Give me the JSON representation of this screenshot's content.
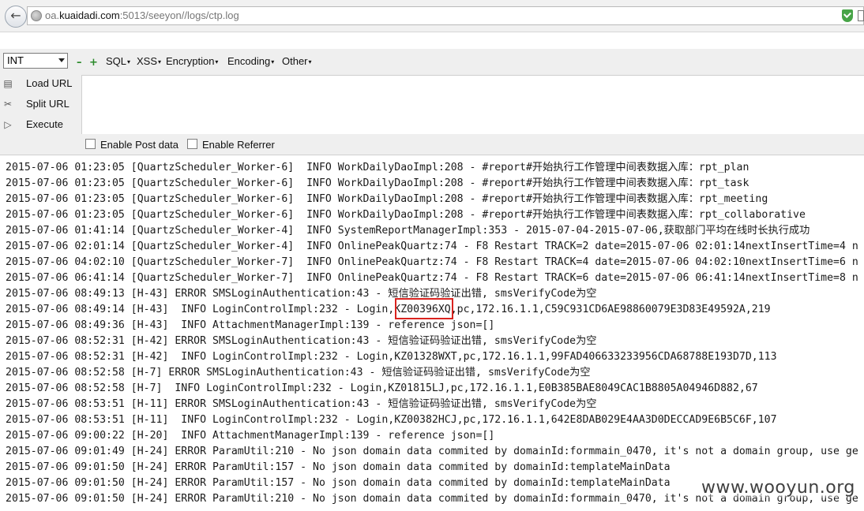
{
  "browser": {
    "url_prefix": "oa.",
    "url_domain": "kuaidadi.com",
    "url_suffix": ":5013/seeyon//logs/ctp.log"
  },
  "hackbar": {
    "select_value": "INT",
    "menus": [
      "SQL",
      "XSS",
      "Encryption",
      "Encoding",
      "Other"
    ],
    "side": [
      "Load URL",
      "Split URL",
      "Execute"
    ],
    "checkboxes": [
      "Enable Post data",
      "Enable Referrer"
    ]
  },
  "log_lines": [
    "2015-07-06 01:23:05 [QuartzScheduler_Worker-6]  INFO WorkDailyDaoImpl:208 - #report#开始执行工作管理中间表数据入库：rpt_plan",
    "2015-07-06 01:23:05 [QuartzScheduler_Worker-6]  INFO WorkDailyDaoImpl:208 - #report#开始执行工作管理中间表数据入库：rpt_task",
    "2015-07-06 01:23:05 [QuartzScheduler_Worker-6]  INFO WorkDailyDaoImpl:208 - #report#开始执行工作管理中间表数据入库：rpt_meeting",
    "2015-07-06 01:23:05 [QuartzScheduler_Worker-6]  INFO WorkDailyDaoImpl:208 - #report#开始执行工作管理中间表数据入库：rpt_collaborative",
    "2015-07-06 01:41:14 [QuartzScheduler_Worker-4]  INFO SystemReportManagerImpl:353 - 2015-07-04-2015-07-06,获取部门平均在线时长执行成功",
    "2015-07-06 02:01:14 [QuartzScheduler_Worker-4]  INFO OnlinePeakQuartz:74 - F8 Restart TRACK=2 date=2015-07-06 02:01:14nextInsertTime=4 n",
    "2015-07-06 04:02:10 [QuartzScheduler_Worker-7]  INFO OnlinePeakQuartz:74 - F8 Restart TRACK=4 date=2015-07-06 04:02:10nextInsertTime=6 n",
    "2015-07-06 06:41:14 [QuartzScheduler_Worker-7]  INFO OnlinePeakQuartz:74 - F8 Restart TRACK=6 date=2015-07-06 06:41:14nextInsertTime=8 n",
    "2015-07-06 08:49:13 [H-43] ERROR SMSLoginAuthentication:43 - 短信验证码验证出错, smsVerifyCode为空",
    "2015-07-06 08:49:14 [H-43]  INFO LoginControlImpl:232 - Login,KZ00396XQ,pc,172.16.1.1,C59C931CD6AE98860079E3D83E49592A,219",
    "2015-07-06 08:49:36 [H-43]  INFO AttachmentManagerImpl:139 - reference json=[]",
    "2015-07-06 08:52:31 [H-42] ERROR SMSLoginAuthentication:43 - 短信验证码验证出错, smsVerifyCode为空",
    "2015-07-06 08:52:31 [H-42]  INFO LoginControlImpl:232 - Login,KZ01328WXT,pc,172.16.1.1,99FAD406633233956CDA68788E193D7D,113",
    "2015-07-06 08:52:58 [H-7] ERROR SMSLoginAuthentication:43 - 短信验证码验证出错, smsVerifyCode为空",
    "2015-07-06 08:52:58 [H-7]  INFO LoginControlImpl:232 - Login,KZ01815LJ,pc,172.16.1.1,E0B385BAE8049CAC1B8805A04946D882,67",
    "2015-07-06 08:53:51 [H-11] ERROR SMSLoginAuthentication:43 - 短信验证码验证出错, smsVerifyCode为空",
    "2015-07-06 08:53:51 [H-11]  INFO LoginControlImpl:232 - Login,KZ00382HCJ,pc,172.16.1.1,642E8DAB029E4AA3D0DECCAD9E6B5C6F,107",
    "2015-07-06 09:00:22 [H-20]  INFO AttachmentManagerImpl:139 - reference json=[]",
    "2015-07-06 09:01:49 [H-24] ERROR ParamUtil:210 - No json domain data commited by domainId:formmain_0470, it's not a domain group, use ge",
    "2015-07-06 09:01:50 [H-24] ERROR ParamUtil:157 - No json domain data commited by domainId:templateMainData",
    "2015-07-06 09:01:50 [H-24] ERROR ParamUtil:157 - No json domain data commited by domainId:templateMainData",
    "2015-07-06 09:01:50 [H-24] ERROR ParamUtil:210 - No json domain data commited by domainId:formmain_0470, it's not a domain group, use ge"
  ],
  "watermark": "www.wooyun.org",
  "colors": {
    "highlight": "#d9231f",
    "toolbar_green": "#2a8a2a",
    "shield": "#47a447"
  }
}
